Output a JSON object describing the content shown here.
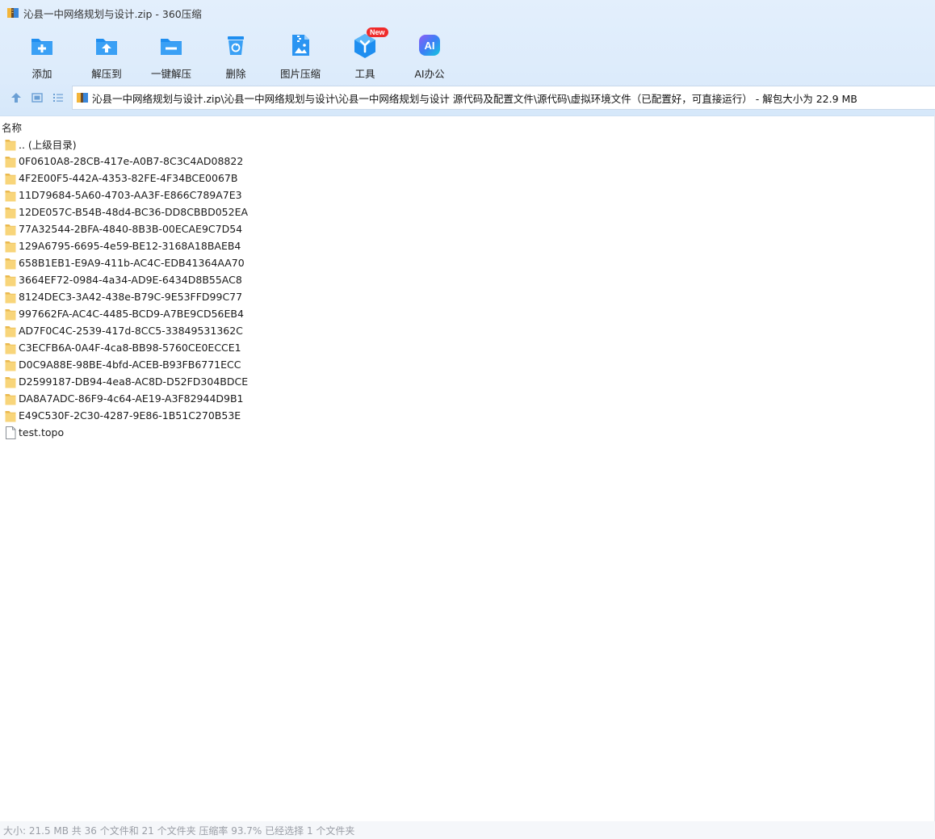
{
  "window": {
    "title": "沁县一中网络规划与设计.zip - 360压缩"
  },
  "toolbar": {
    "items": [
      {
        "label": "添加",
        "icon": "add-icon"
      },
      {
        "label": "解压到",
        "icon": "extract-to-icon"
      },
      {
        "label": "一键解压",
        "icon": "one-click-extract-icon"
      },
      {
        "label": "删除",
        "icon": "delete-icon"
      },
      {
        "label": "图片压缩",
        "icon": "image-compress-icon"
      },
      {
        "label": "工具",
        "icon": "tools-icon",
        "badge": "New"
      },
      {
        "label": "AI办公",
        "icon": "ai-office-icon",
        "icon_text": "AI"
      }
    ]
  },
  "address": {
    "path": "沁县一中网络规划与设计.zip\\沁县一中网络规划与设计\\沁县一中网络规划与设计 源代码及配置文件\\源代码\\虚拟环境文件（已配置好，可直接运行） - 解包大小为 22.9 MB"
  },
  "list": {
    "header": "名称",
    "items": [
      {
        "name": ".. (上级目录)",
        "type": "folder"
      },
      {
        "name": "0F0610A8-28CB-417e-A0B7-8C3C4AD08822",
        "type": "folder"
      },
      {
        "name": "4F2E00F5-442A-4353-82FE-4F34BCE0067B",
        "type": "folder"
      },
      {
        "name": "11D79684-5A60-4703-AA3F-E866C789A7E3",
        "type": "folder"
      },
      {
        "name": "12DE057C-B54B-48d4-BC36-DD8CBBD052EA",
        "type": "folder"
      },
      {
        "name": "77A32544-2BFA-4840-8B3B-00ECAE9C7D54",
        "type": "folder"
      },
      {
        "name": "129A6795-6695-4e59-BE12-3168A18BAEB4",
        "type": "folder"
      },
      {
        "name": "658B1EB1-E9A9-411b-AC4C-EDB41364AA70",
        "type": "folder"
      },
      {
        "name": "3664EF72-0984-4a34-AD9E-6434D8B55AC8",
        "type": "folder"
      },
      {
        "name": "8124DEC3-3A42-438e-B79C-9E53FFD99C77",
        "type": "folder"
      },
      {
        "name": "997662FA-AC4C-4485-BCD9-A7BE9CD56EB4",
        "type": "folder"
      },
      {
        "name": "AD7F0C4C-2539-417d-8CC5-33849531362C",
        "type": "folder"
      },
      {
        "name": "C3ECFB6A-0A4F-4ca8-BB98-5760CE0ECCE1",
        "type": "folder"
      },
      {
        "name": "D0C9A88E-98BE-4bfd-ACEB-B93FB6771ECC",
        "type": "folder"
      },
      {
        "name": "D2599187-DB94-4ea8-AC8D-D52FD304BDCE",
        "type": "folder"
      },
      {
        "name": "DA8A7ADC-86F9-4c64-AE19-A3F82944D9B1",
        "type": "folder"
      },
      {
        "name": "E49C530F-2C30-4287-9E86-1B51C270B53E",
        "type": "folder"
      },
      {
        "name": "test.topo",
        "type": "file"
      }
    ]
  },
  "status": {
    "text": "大小: 21.5 MB 共 36 个文件和 21 个文件夹 压缩率 93.7% 已经选择 1 个文件夹"
  },
  "colors": {
    "accent": "#1e8ef0",
    "folder": "#f7cf6a",
    "badge": "#ef2b2b",
    "chrome": "#dcebfb"
  }
}
